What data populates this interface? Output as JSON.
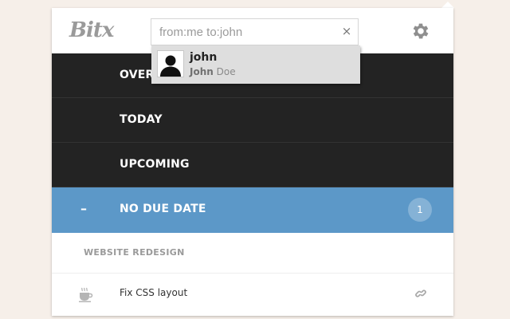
{
  "app": {
    "logo": "Bitx"
  },
  "search": {
    "value": "from:me to:john",
    "clear_glyph": "×"
  },
  "suggestion": {
    "username": "john",
    "first_name": "John",
    "last_name": "Doe"
  },
  "nav": {
    "items": [
      {
        "label": "OVERDUE"
      },
      {
        "label": "TODAY"
      },
      {
        "label": "UPCOMING"
      },
      {
        "label": "NO DUE DATE",
        "toggle": "–",
        "count": "1",
        "active": true
      }
    ]
  },
  "project": {
    "title": "WEBSITE REDESIGN"
  },
  "task": {
    "text": "Fix CSS layout"
  },
  "colors": {
    "background": "#f6efe9",
    "nav_dark": "#232323",
    "active_blue": "#5c98c8",
    "muted_text": "#9a9a9a"
  },
  "icons": {
    "settings": "gear-icon",
    "user": "user-avatar-icon",
    "task": "coffee-cup-icon",
    "link": "link-icon",
    "clear": "close-icon"
  }
}
